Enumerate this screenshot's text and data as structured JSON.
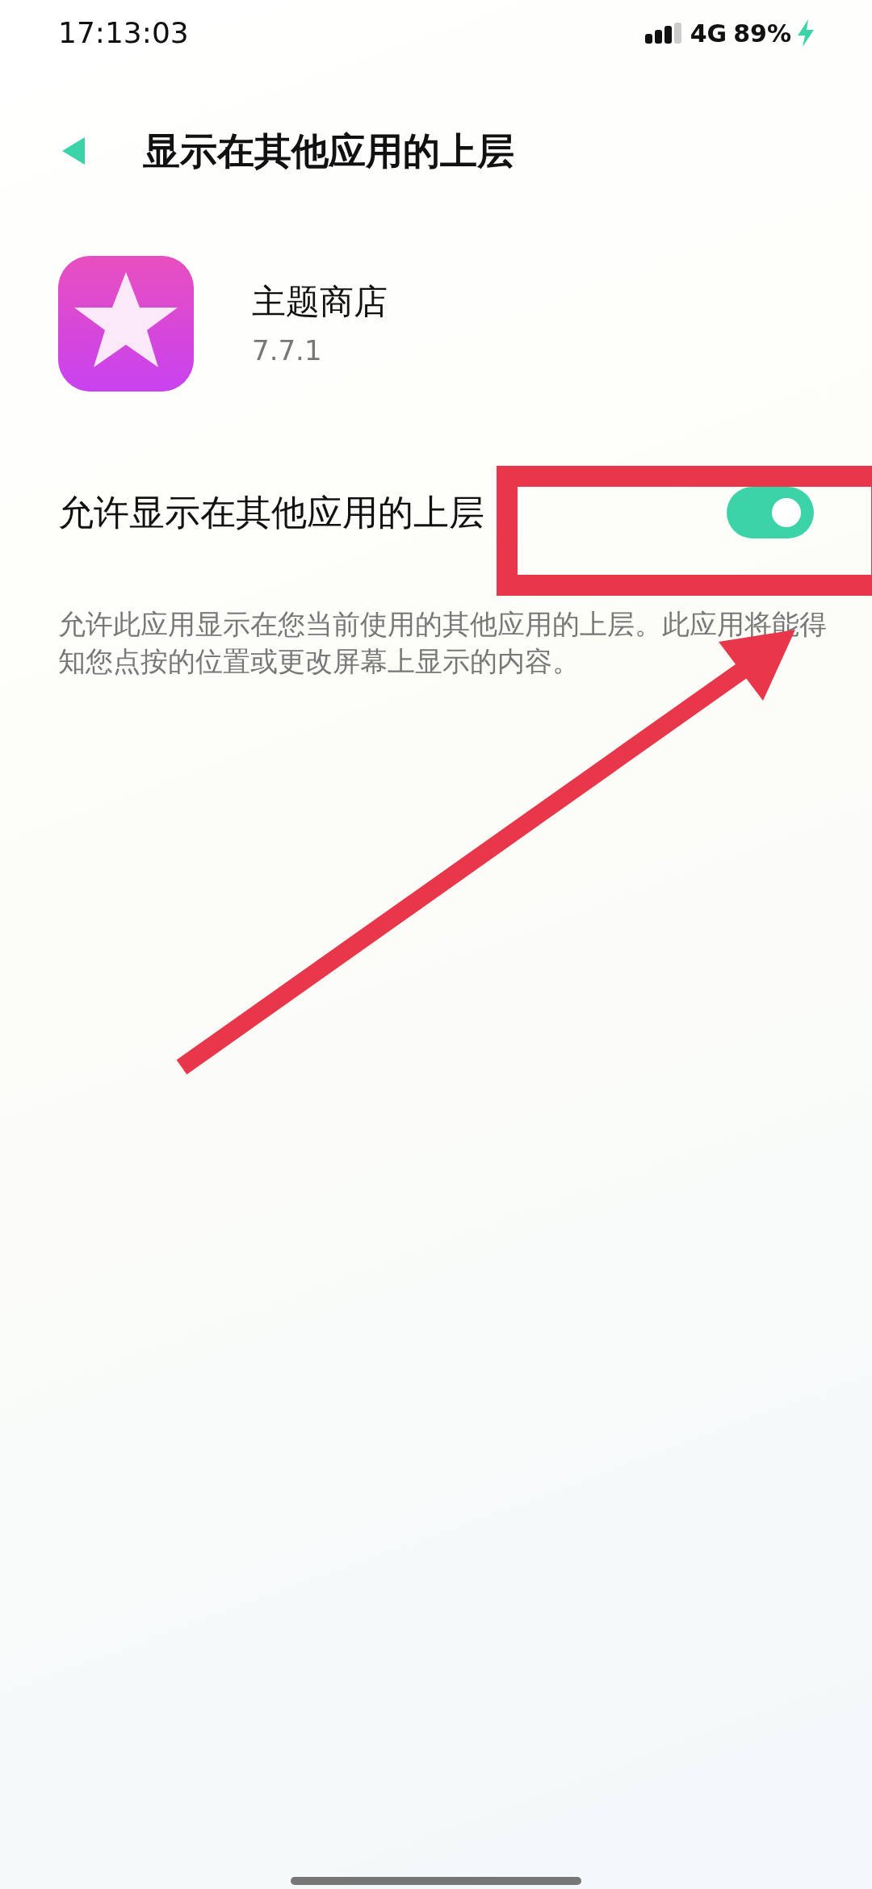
{
  "status_bar": {
    "time": "17:13:03",
    "network": "4G",
    "battery": "89%",
    "charging": true
  },
  "header": {
    "title": "显示在其他应用的上层"
  },
  "app": {
    "name": "主题商店",
    "version": "7.7.1"
  },
  "setting": {
    "label": "允许显示在其他应用的上层",
    "on": true
  },
  "description": "允许此应用显示在您当前使用的其他应用的上层。此应用将能得知您点按的位置或更改屏幕上显示的内容。"
}
